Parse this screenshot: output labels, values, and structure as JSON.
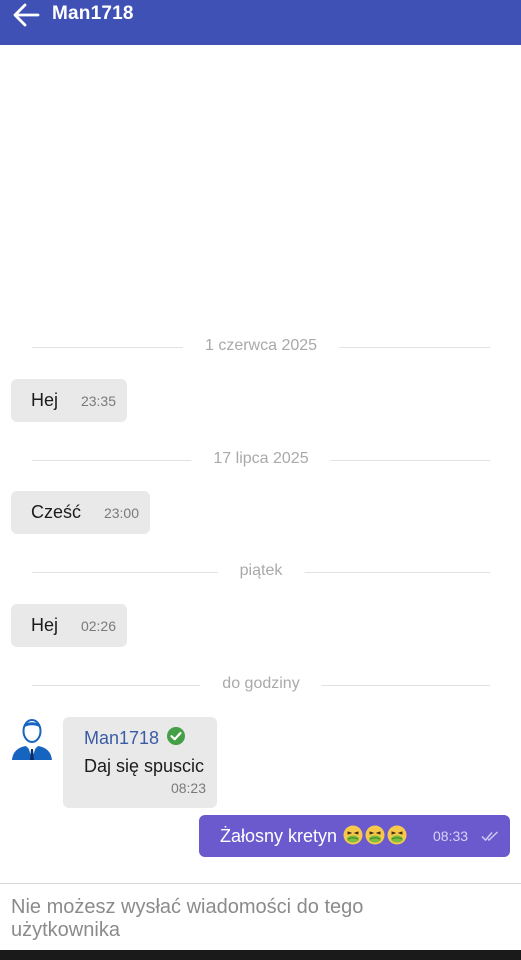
{
  "header": {
    "title": "Man1718",
    "back_icon": "arrow-back-icon",
    "background": "#3f51b5"
  },
  "chat": {
    "date_dividers": [
      "1 czerwca 2025",
      "17 lipca 2025",
      "piątek",
      "do godziny"
    ],
    "incoming": [
      {
        "text": "Hej",
        "time": "23:35"
      },
      {
        "text": "Cześć",
        "time": "23:00"
      },
      {
        "text": "Hej",
        "time": "02:26"
      }
    ],
    "card": {
      "avatar_icon": "user-avatar-icon",
      "sender": "Man1718",
      "verified_icon": "verified-check-icon",
      "text": "Daj się spuscic",
      "time": "08:23"
    },
    "outgoing": {
      "text": "Żałosny kretyn",
      "emoji": [
        "nauseated-face",
        "nauseated-face",
        "nauseated-face"
      ],
      "time": "08:33",
      "status_icon": "double-check-icon",
      "background": "#6a5acd"
    }
  },
  "composer": {
    "notice": "Nie możesz wysłać wiadomości do tego użytkownika"
  }
}
